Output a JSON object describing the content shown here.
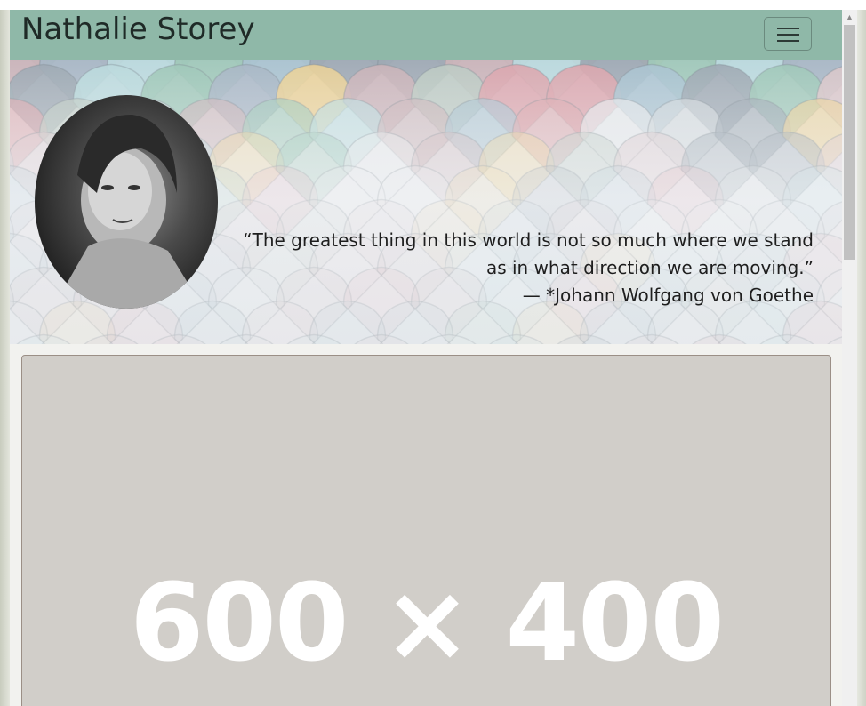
{
  "navbar": {
    "brand": "Nathalie Storey",
    "toggler_icon": "hamburger-menu-icon"
  },
  "hero": {
    "quote": "“The greatest thing in this world is not so much where we stand as in what direction we are moving.”",
    "cite": "— *Johann Wolfgang von Goethe",
    "background": "pastel-roof-tiles",
    "portrait": "black-and-white-portrait"
  },
  "placeholder": {
    "text": "600 × 400"
  },
  "colors": {
    "navbar": "#8fb8a8",
    "placeholder_bg": "#d1cec9",
    "placeholder_text": "#ffffff"
  }
}
